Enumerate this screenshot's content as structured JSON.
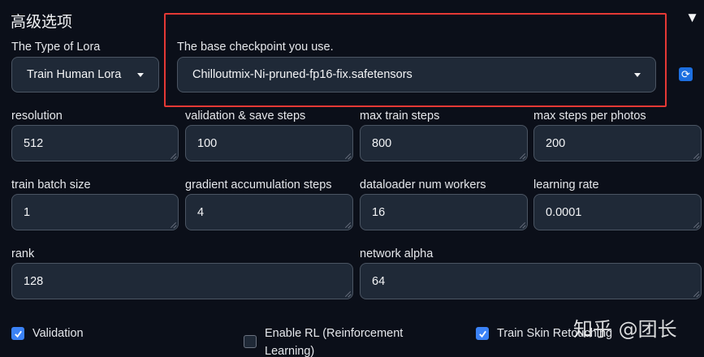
{
  "section": {
    "title": "高级选项",
    "collapse_icon": "triangle-down-icon"
  },
  "lora_type": {
    "label": "The Type of Lora",
    "value": "Train Human Lora"
  },
  "checkpoint": {
    "label": "The base checkpoint you use.",
    "value": "Chilloutmix-Ni-pruned-fp16-fix.safetensors",
    "refresh_icon": "refresh-icon"
  },
  "fields": {
    "resolution": {
      "label": "resolution",
      "value": "512"
    },
    "validation_save_steps": {
      "label": "validation & save steps",
      "value": "100"
    },
    "max_train_steps": {
      "label": "max train steps",
      "value": "800"
    },
    "max_steps_per_photos": {
      "label": "max steps per photos",
      "value": "200"
    },
    "train_batch_size": {
      "label": "train batch size",
      "value": "1"
    },
    "gradient_accumulation_steps": {
      "label": "gradient accumulation steps",
      "value": "4"
    },
    "dataloader_num_workers": {
      "label": "dataloader num workers",
      "value": "16"
    },
    "learning_rate": {
      "label": "learning rate",
      "value": "0.0001"
    },
    "rank": {
      "label": "rank",
      "value": "128"
    },
    "network_alpha": {
      "label": "network alpha",
      "value": "64"
    }
  },
  "checkboxes": {
    "validation": {
      "label": "Validation",
      "checked": true
    },
    "enable_rl": {
      "label_line1": "Enable RL (Reinforcement",
      "label_line2": "Learning)",
      "checked": false
    },
    "train_skin_retouching": {
      "label": "Train Skin Retouching",
      "checked": true
    }
  },
  "watermark": "知乎 @团长",
  "colors": {
    "accent": "#3b82f6",
    "highlight_border": "#e53935",
    "background": "#0b0f19",
    "input_bg": "#1f2937"
  }
}
